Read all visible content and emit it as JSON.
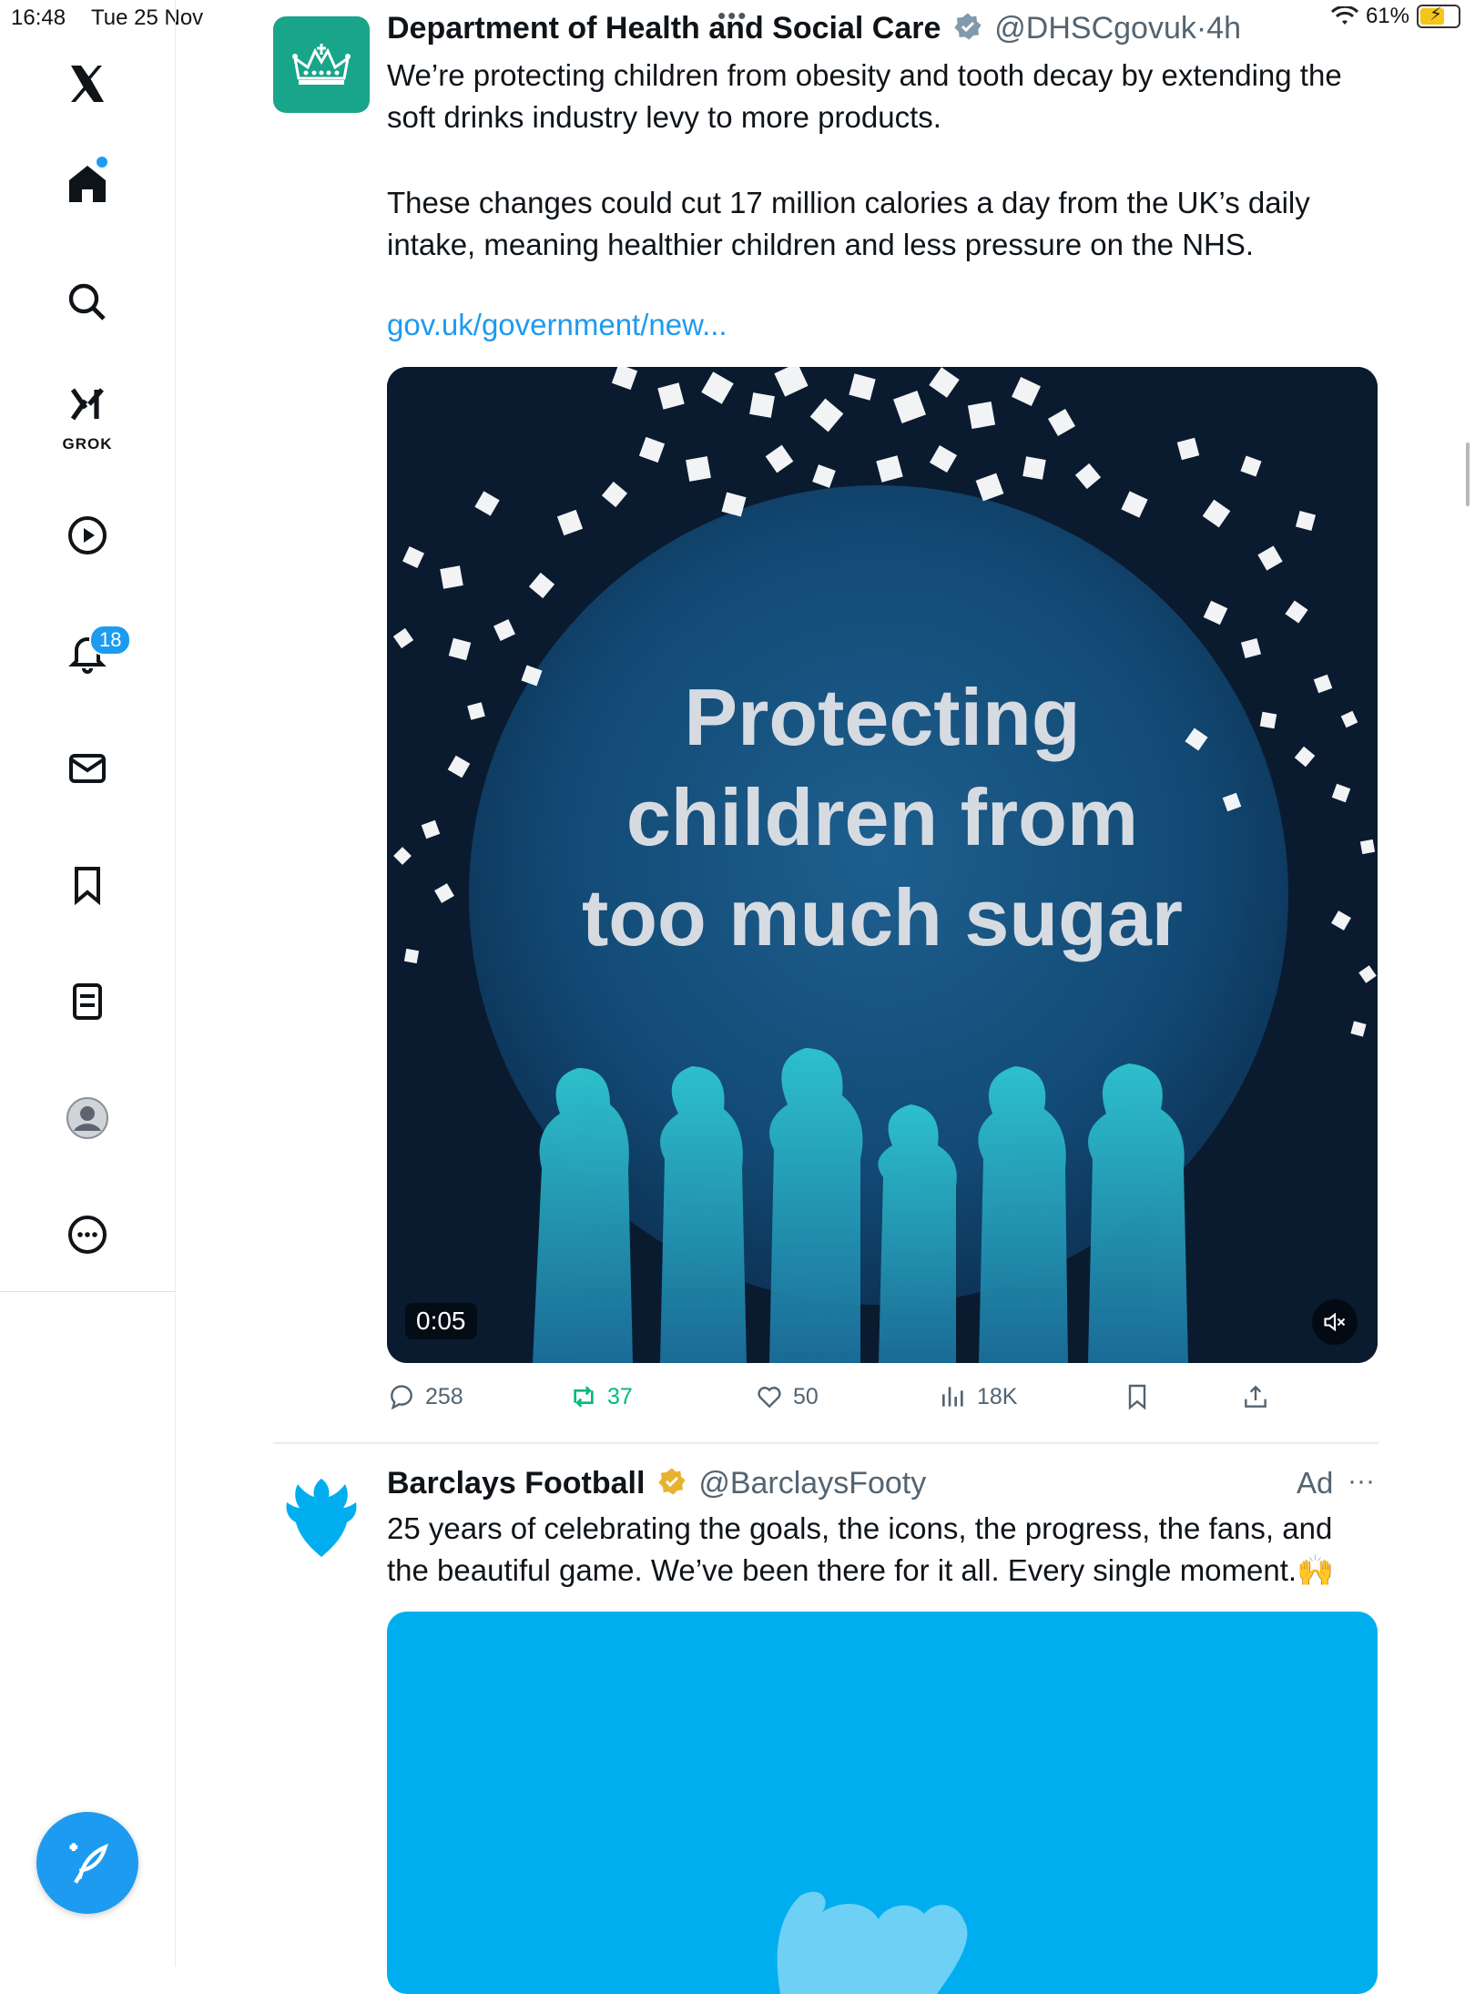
{
  "status_bar": {
    "time": "16:48",
    "date": "Tue 25 Nov",
    "battery": "61%"
  },
  "sidebar": {
    "grok_label": "GROK",
    "notifications_badge": "18"
  },
  "tweet1": {
    "name": "Department of Health and Social Care",
    "handle": "@DHSCgovuk",
    "dot": "·",
    "age": "4h",
    "text1": "We’re protecting children from obesity and tooth decay by extending the soft drinks industry levy to more products.",
    "text2": "These changes could cut 17 million calories a day from the UK’s daily intake, meaning healthier children and less pressure on the NHS.",
    "link": "gov.uk/government/new...",
    "media": {
      "headline_line1": "Protecting",
      "headline_line2": "children from",
      "headline_line3": "too much sugar",
      "timestamp": "0:05"
    },
    "actions": {
      "replies": "258",
      "reposts": "37",
      "likes": "50",
      "views": "18K"
    }
  },
  "tweet2": {
    "name": "Barclays Football",
    "handle": "@BarclaysFooty",
    "ad_label": "Ad",
    "text": "25 years of celebrating the goals, the icons, the progress, the fans, and the beautiful game. We’ve been there for it all. Every single moment.🙌"
  },
  "colors": {
    "accent": "#1d9bf0",
    "repost_green": "#00ba7c",
    "dhsc_green": "#18a58a",
    "barclays_blue": "#00aeef"
  }
}
